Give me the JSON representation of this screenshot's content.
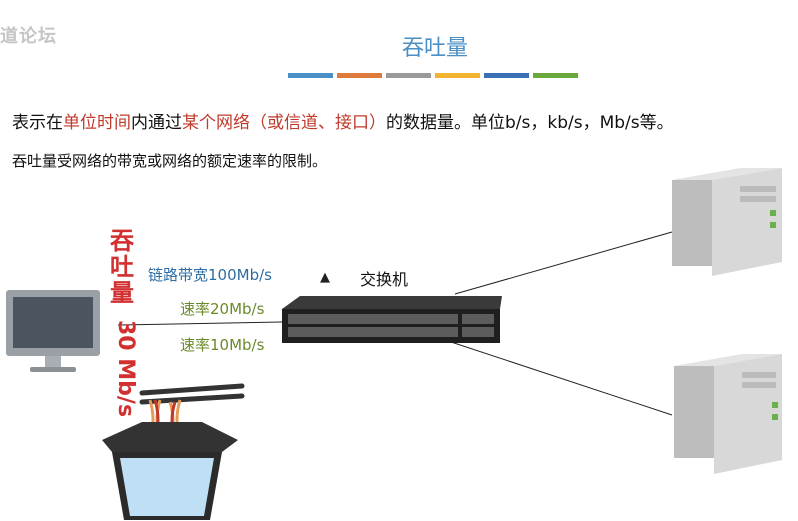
{
  "watermark": "道论坛",
  "title": "吞吐量",
  "title_bar_colors": [
    "#4a90c8",
    "#e07a3a",
    "#9a9a9a",
    "#f2b431",
    "#3a6fb5",
    "#6aaa3a"
  ],
  "definition": {
    "p1": "表示在",
    "p2": "单位时间",
    "p3": "内通过",
    "p4": "某个网络（或信道、接口）",
    "p5": "的数据量。单位b/s，kb/s，Mb/s等。"
  },
  "note": "吞吐量受网络的带宽或网络的额定速率的限制。",
  "throughput": {
    "chars": [
      "吞",
      "吐",
      "量"
    ],
    "rate": "30 Mb/s"
  },
  "labels": {
    "bandwidth": "链路带宽100Mb/s",
    "rate_20": "速率20Mb/s",
    "rate_10": "速率10Mb/s",
    "switch": "交换机"
  },
  "colors": {
    "accent_red": "#d23030",
    "title_blue": "#4a8fc6",
    "rate_green": "#6b8a2a",
    "bandwidth_blue": "#2e6da4"
  }
}
